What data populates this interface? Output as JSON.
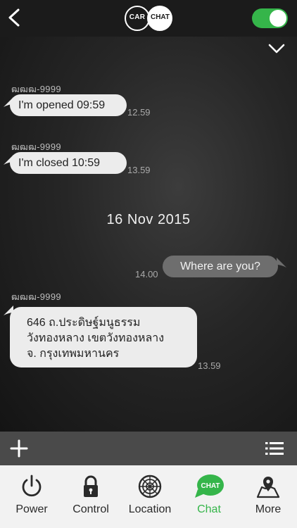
{
  "header": {
    "logo_left": "CAR",
    "logo_right": "CHAT",
    "toggle_on": true
  },
  "colors": {
    "accent": "#35b54a",
    "incoming_bubble": "#ececec",
    "outgoing_bubble": "#6e6e6e",
    "tab_bar": "#f2f2f2"
  },
  "messages": [
    {
      "sender": "ฒฒฒ-9999",
      "text": "I'm opened 09:59",
      "time": "12.59",
      "direction": "incoming"
    },
    {
      "sender": "ฒฒฒ-9999",
      "text": "I'm closed 10:59",
      "time": "13.59",
      "direction": "incoming"
    },
    {
      "date_separator": "16 Nov 2015"
    },
    {
      "text": "Where are you?",
      "time": "14.00",
      "direction": "outgoing"
    },
    {
      "sender": "ฒฒฒ-9999",
      "lines": [
        "646 ถ.ประดิษฐ์มนูธรรม",
        "วังทองหลาง เขตวังทองหลาง",
        "จ. กรุงเทพมหานคร"
      ],
      "time": "13.59",
      "direction": "incoming"
    }
  ],
  "icons": {
    "back": "chevron-left-icon",
    "collapse": "chevron-down-icon",
    "add": "plus-icon",
    "menu": "list-icon"
  },
  "tabs": [
    {
      "label": "Power",
      "icon": "power-icon",
      "active": false
    },
    {
      "label": "Control",
      "icon": "lock-icon",
      "active": false
    },
    {
      "label": "Location",
      "icon": "radar-icon",
      "active": false
    },
    {
      "label": "Chat",
      "icon": "chat-bubble-icon",
      "badge": "CHAT",
      "active": true
    },
    {
      "label": "More",
      "icon": "map-pin-icon",
      "active": false
    }
  ]
}
